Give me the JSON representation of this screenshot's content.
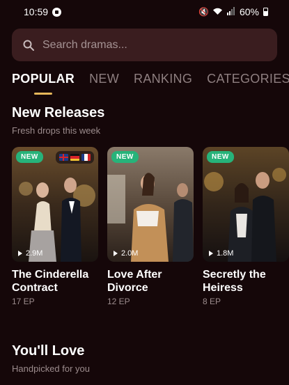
{
  "status_bar": {
    "time": "10:59",
    "battery": "60%",
    "system_icons": "mute-icon wifi-icon signal-icon"
  },
  "search": {
    "placeholder": "Search dramas..."
  },
  "tabs": [
    {
      "label": "POPULAR",
      "active": true
    },
    {
      "label": "NEW",
      "active": false
    },
    {
      "label": "RANKING",
      "active": false
    },
    {
      "label": "CATEGORIES",
      "active": false
    }
  ],
  "new_releases": {
    "title": "New Releases",
    "subtitle": "Fresh drops this week",
    "items": [
      {
        "badge": "NEW",
        "views": "2.9M",
        "title_line1": "The Cinderella",
        "title_line2": "Contract",
        "episodes": "17 EP",
        "flags": [
          "uk",
          "de",
          "fr"
        ]
      },
      {
        "badge": "NEW",
        "views": "2.0M",
        "title_line1": "Love After",
        "title_line2": "Divorce",
        "episodes": "12 EP"
      },
      {
        "badge": "NEW",
        "views": "1.8M",
        "title_line1": "Secretly the",
        "title_line2": "Heiress",
        "episodes": "8 EP"
      }
    ]
  },
  "youll_love": {
    "title": "You'll Love",
    "subtitle": "Handpicked for you"
  },
  "colors": {
    "background": "#150709",
    "search_bg": "#3a1d1f",
    "accent_underline": "#e6b75a",
    "badge_green": "#27b37a"
  }
}
